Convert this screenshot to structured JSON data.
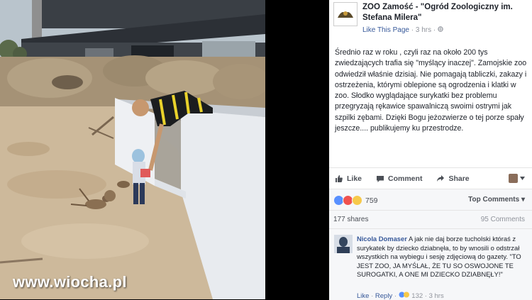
{
  "photo": {
    "watermark": "www.wiocha.pl"
  },
  "post": {
    "page_name": "ZOO Zamość - \"Ogród Zoologiczny im. Stefana Milera\"",
    "like_page": "Like This Page",
    "time": "3 hrs",
    "body": "Średnio raz w roku , czyli raz na około 200 tys zwiedzających trafia się \"myślący inaczej\". Zamojskie zoo odwiedził właśnie dzisiaj. Nie pomagają tabliczki, zakazy i ostrzeżenia, którymi oblepione są ogrodzenia i klatki w zoo. Słodko wyglądające surykatki bez problemu przegryzają rękawice spawalniczą swoimi ostrymi jak szpilki zębami. Dzięki Bogu jeżozwierze o tej porze spały jeszcze.... publikujemy ku przestrodze.",
    "actions": {
      "like": "Like",
      "comment": "Comment",
      "share": "Share"
    },
    "reactions_count": "759",
    "top_comments": "Top Comments",
    "shares": "177 shares",
    "comments_count": "95 Comments"
  },
  "comment": {
    "author": "Nicola Domaser",
    "text": "A jak nie daj borze tucholski któraś z surykatek by dziecko dziabnęła, to by wnosili o odstrzał wszystkich na wybiegu i sesję zdjęciową do gazety. \"TO JEST ZOO, JA MYŚLAŁ, ŻE TU SO OSWOJONE TE SUROGATKI, A ONE MI DZIECKO DZIABNĘŁY!\"",
    "like": "Like",
    "reply": "Reply",
    "reactions": "132",
    "time": "3 hrs"
  },
  "colors": {
    "link": "#365899",
    "text": "#1d2129",
    "muted": "#90949c",
    "panel_bg": "#f6f7f9"
  }
}
